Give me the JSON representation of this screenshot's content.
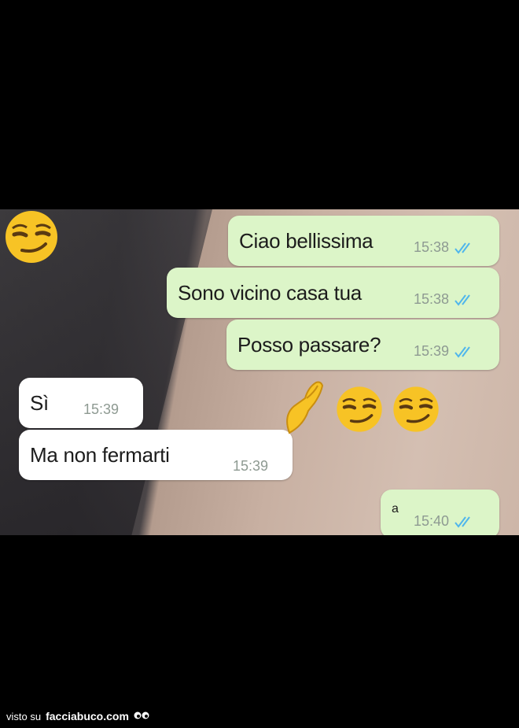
{
  "messages": [
    {
      "id": "m1",
      "dir": "out",
      "text": "Ciao bellissima",
      "time": "15:38",
      "ticks": true
    },
    {
      "id": "m2",
      "dir": "out",
      "text": "Sono vicino casa tua",
      "time": "15:38",
      "ticks": true
    },
    {
      "id": "m3",
      "dir": "out",
      "text": "Posso passare?",
      "time": "15:39",
      "ticks": true
    },
    {
      "id": "m4",
      "dir": "in",
      "text": "Sì",
      "time": "15:39",
      "ticks": false
    },
    {
      "id": "m5",
      "dir": "in",
      "text": "Ma non fermarti",
      "time": "15:39",
      "ticks": false
    },
    {
      "id": "m6",
      "dir": "out",
      "text": "a",
      "time": "15:40",
      "ticks": true
    }
  ],
  "emojis": [
    "smirk-emoji",
    "pinched-fingers-emoji",
    "smirk-emoji",
    "smirk-emoji"
  ],
  "colors": {
    "outgoing_bubble": "#dcf5c8",
    "incoming_bubble": "#ffffff",
    "read_ticks": "#4fb6ec",
    "emoji_yellow": "#f7c325"
  },
  "footer": {
    "prefix": "visto su",
    "site": "facciabuco.com"
  }
}
